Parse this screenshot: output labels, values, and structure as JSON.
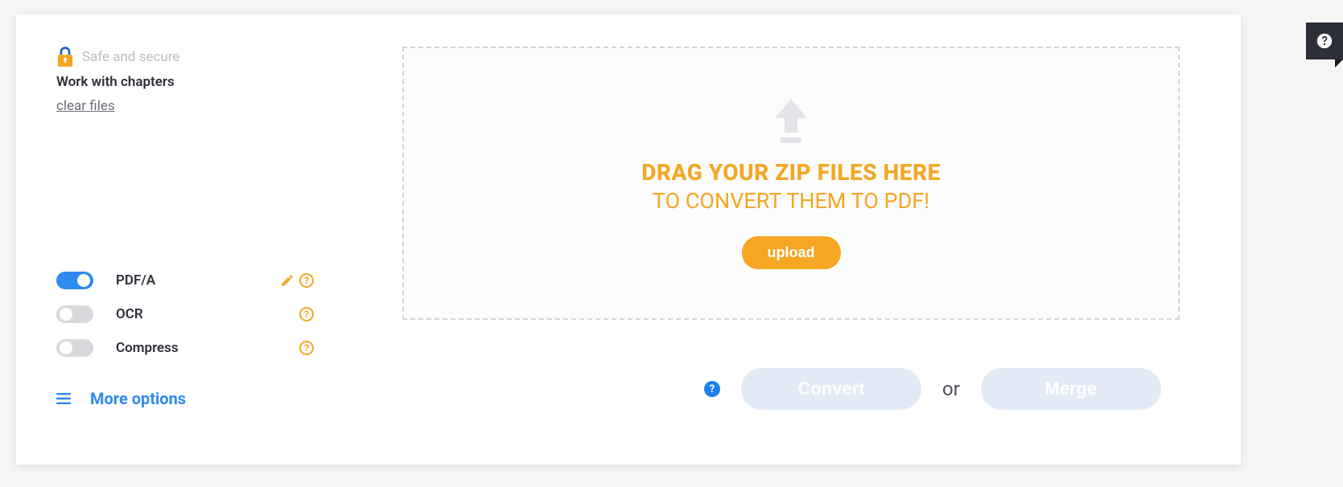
{
  "secure_text": "Safe and secure",
  "chapters_text": "Work with chapters",
  "clear_files": "clear files",
  "options": {
    "pdfa": {
      "label": "PDF/A",
      "on": true
    },
    "ocr": {
      "label": "OCR",
      "on": false
    },
    "compress": {
      "label": "Compress",
      "on": false
    }
  },
  "more_options": "More options",
  "dropzone": {
    "title": "DRAG YOUR ZIP FILES HERE",
    "subtitle": "TO CONVERT THEM TO PDF!",
    "upload_label": "upload"
  },
  "actions": {
    "convert": "Convert",
    "or": "or",
    "merge": "Merge"
  }
}
